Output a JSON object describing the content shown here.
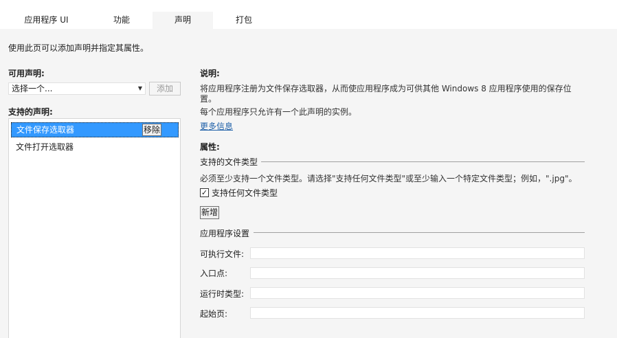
{
  "tabs": [
    {
      "label": "应用程序 UI"
    },
    {
      "label": "功能"
    },
    {
      "label": "声明"
    },
    {
      "label": "打包"
    }
  ],
  "intro": "使用此页可以添加声明并指定其属性。",
  "available": {
    "label": "可用声明:",
    "select_value": "选择一个...",
    "add_button": "添加"
  },
  "supported": {
    "label": "支持的声明:",
    "items": [
      {
        "label": "文件保存选取器",
        "remove_button": "移除"
      },
      {
        "label": "文件打开选取器"
      }
    ]
  },
  "description": {
    "label": "说明:",
    "line1": "将应用程序注册为文件保存选取器，从而使应用程序成为可供其他 Windows 8 应用程序使用的保存位",
    "line2": "置。",
    "line3": "每个应用程序只允许有一个此声明的实例。",
    "more_info": "更多信息"
  },
  "properties": {
    "label": "属性:",
    "file_types_group": "支持的文件类型",
    "file_types_hint": "必须至少支持一个文件类型。请选择\"支持任何文件类型\"或至少输入一个特定文件类型；例如，\".jpg\"。",
    "any_type_checkbox": "支持任何文件类型",
    "any_type_checked": true,
    "new_button": "新增",
    "app_settings_group": "应用程序设置",
    "fields": [
      {
        "label": "可执行文件:",
        "value": ""
      },
      {
        "label": "入口点:",
        "value": ""
      },
      {
        "label": "运行时类型:",
        "value": ""
      },
      {
        "label": "起始页:",
        "value": ""
      }
    ]
  }
}
